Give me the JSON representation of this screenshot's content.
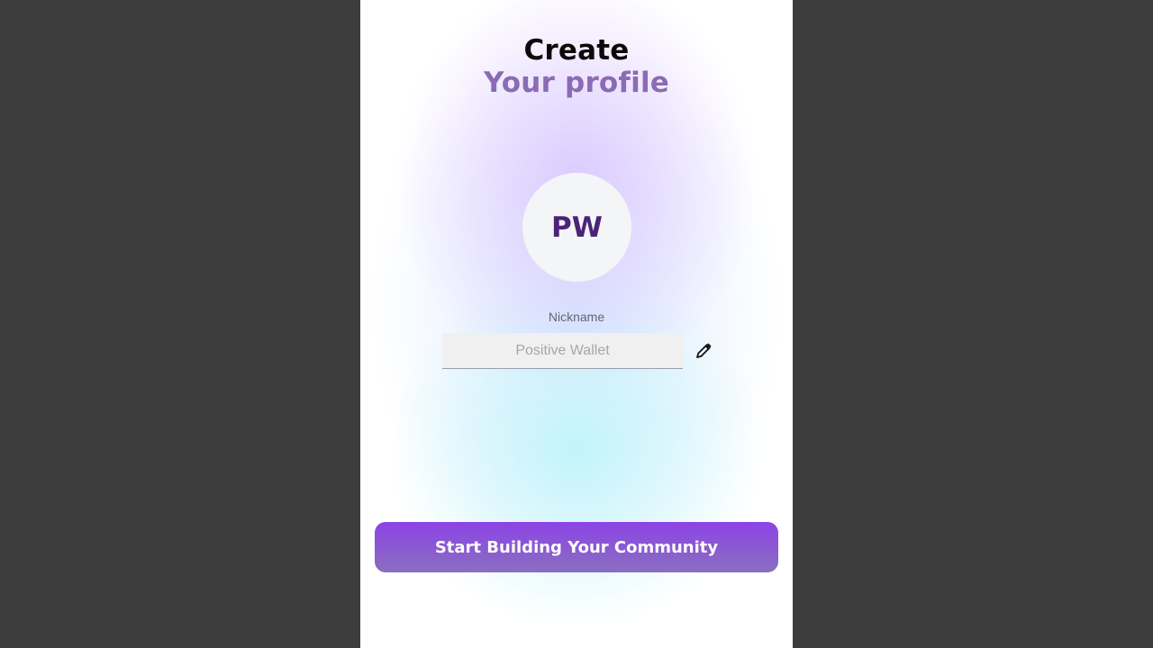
{
  "header": {
    "title_line1": "Create",
    "title_line2": "Your profile"
  },
  "avatar": {
    "initials": "PW"
  },
  "nickname": {
    "label": "Nickname",
    "placeholder": "Positive Wallet",
    "value": "",
    "edit_icon": "pencil-icon"
  },
  "actions": {
    "primary_label": "Start Building Your Community"
  },
  "colors": {
    "accent": "#8c43e6",
    "title_secondary": "#8b6bb5",
    "initials": "#4b2378",
    "backdrop": "#3d3d3d"
  }
}
